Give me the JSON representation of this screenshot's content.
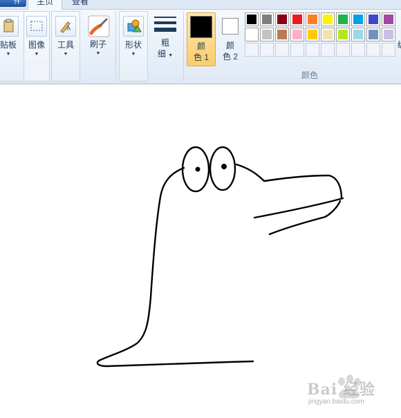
{
  "tabs": {
    "file_label": "件",
    "home_label": "主页",
    "view_label": "查看"
  },
  "ribbon": {
    "clipboard": {
      "label": "贴板"
    },
    "image": {
      "label": "图像"
    },
    "tools": {
      "label": "工具"
    },
    "brushes": {
      "label": "刷子"
    },
    "shapes": {
      "label": "形状"
    },
    "size": {
      "label_line1": "粗",
      "label_line2": "细"
    },
    "color1": {
      "label_line1": "颜",
      "label_line2": "色 1",
      "color": "#000000"
    },
    "color2": {
      "label_line1": "颜",
      "label_line2": "色 2",
      "color": "#ffffff"
    },
    "palette_group_label": "颜色",
    "edit_colors_label": "编"
  },
  "palette": {
    "row1": [
      "#000000",
      "#7f7f7f",
      "#880015",
      "#ed1c24",
      "#ff7f27",
      "#fff200",
      "#22b14c",
      "#00a2e8",
      "#3f48cc",
      "#a349a4"
    ],
    "row2": [
      "#ffffff",
      "#c3c3c3",
      "#b97a57",
      "#ffaec9",
      "#ffc90e",
      "#efe4b0",
      "#b5e61d",
      "#99d9ea",
      "#7092be",
      "#c8bfe7"
    ],
    "row3_empty_count": 10
  },
  "watermark": {
    "brand": "Bai 经验",
    "url": "jingyan.baidu.com"
  }
}
